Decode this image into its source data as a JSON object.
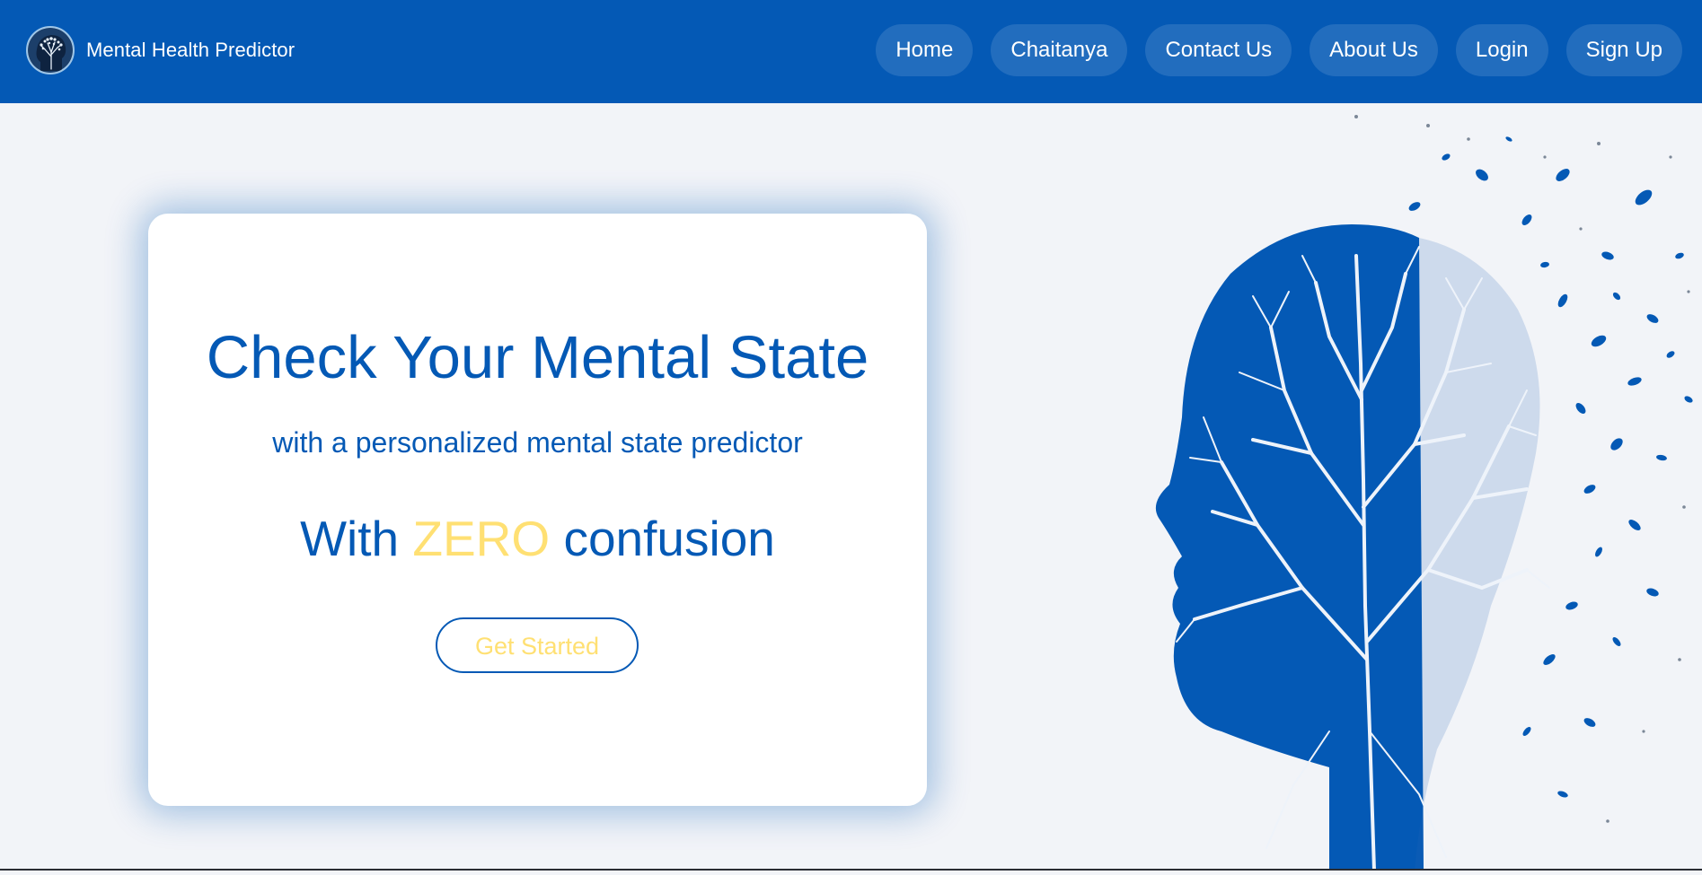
{
  "header": {
    "brand_name": "Mental Health Predictor",
    "logo_icon": "tree-head-logo-icon",
    "nav": [
      {
        "label": "Home"
      },
      {
        "label": "Chaitanya"
      },
      {
        "label": "Contact Us"
      },
      {
        "label": "About Us"
      },
      {
        "label": "Login"
      },
      {
        "label": "Sign Up"
      }
    ]
  },
  "hero": {
    "title": "Check Your Mental State",
    "subtitle": "with a personalized mental state predictor",
    "zero_prefix": "With",
    "zero_highlight": "ZERO",
    "zero_suffix": "confusion",
    "cta_label": "Get Started"
  },
  "illustration": {
    "icon": "tree-head-silhouette-icon"
  },
  "colors": {
    "primary": "#0459b5",
    "accent": "#ffe073",
    "page_background": "#f2f4f8",
    "card_background": "#ffffff"
  }
}
